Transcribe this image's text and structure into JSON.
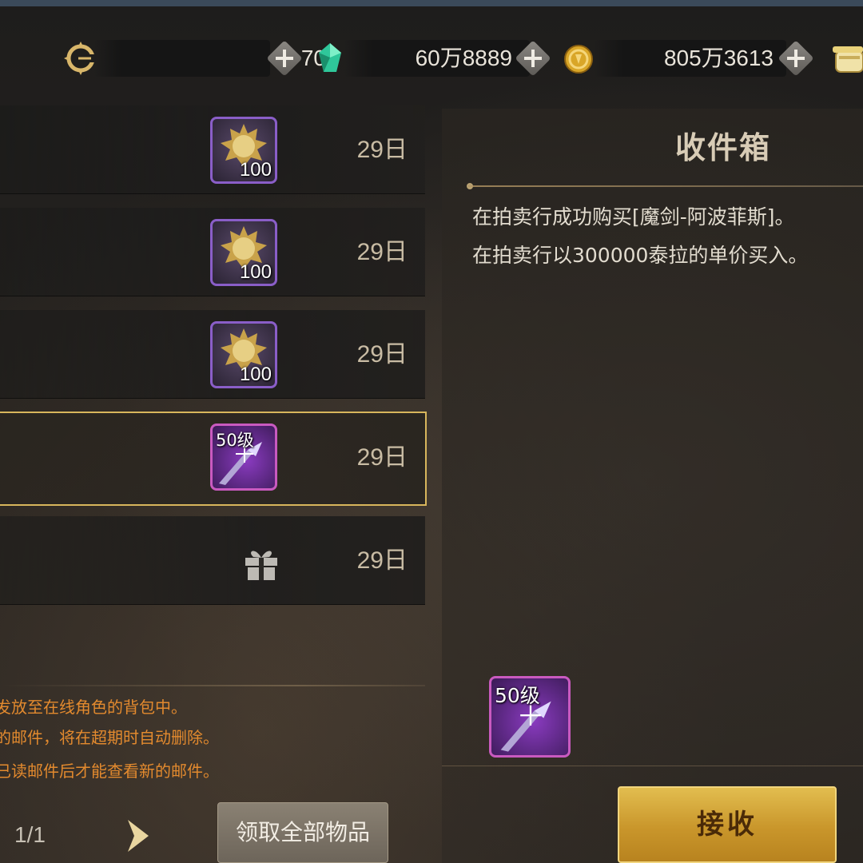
{
  "currency": {
    "stamina": {
      "icon": "stamina-c-icon",
      "value": "70"
    },
    "crystal": {
      "icon": "crystal-icon",
      "value": "60万8889"
    },
    "gold": {
      "icon": "gold-coin-icon",
      "value": "805万3613"
    },
    "extra": {
      "icon": "treasure-pot-icon"
    }
  },
  "mail_list": [
    {
      "days": "29日",
      "item": {
        "icon": "gold-gear-token-icon",
        "qty": "100"
      }
    },
    {
      "days": "29日",
      "item": {
        "icon": "gold-gear-token-icon",
        "qty": "100"
      }
    },
    {
      "days": "29日",
      "item": {
        "icon": "gold-gear-token-icon",
        "qty": "100"
      }
    },
    {
      "days": "29日",
      "item": {
        "icon": "purple-sword-icon",
        "level": "50级"
      },
      "selected": true
    },
    {
      "days": "29日",
      "item": {
        "icon": "gift-box-icon"
      }
    }
  ],
  "notes": [
    "发放至在线角色的背包中。",
    "的邮件，将在超期时自动删除。",
    "已读邮件后才能查看新的邮件。"
  ],
  "pager": {
    "text": "1/1"
  },
  "buttons": {
    "collect_all": "领取全部物品",
    "receive": "接收"
  },
  "detail": {
    "title": "收件箱",
    "lines": [
      "在拍卖行成功购买[魔剑-阿波菲斯]。",
      "在拍卖行以300000泰拉的单价买入。"
    ],
    "attachment": {
      "icon": "purple-sword-icon",
      "level": "50级"
    }
  },
  "colors": {
    "accent_gold": "#d8b65c",
    "note_orange": "#e38a2e",
    "epic_purple": "#8a5ec8"
  }
}
